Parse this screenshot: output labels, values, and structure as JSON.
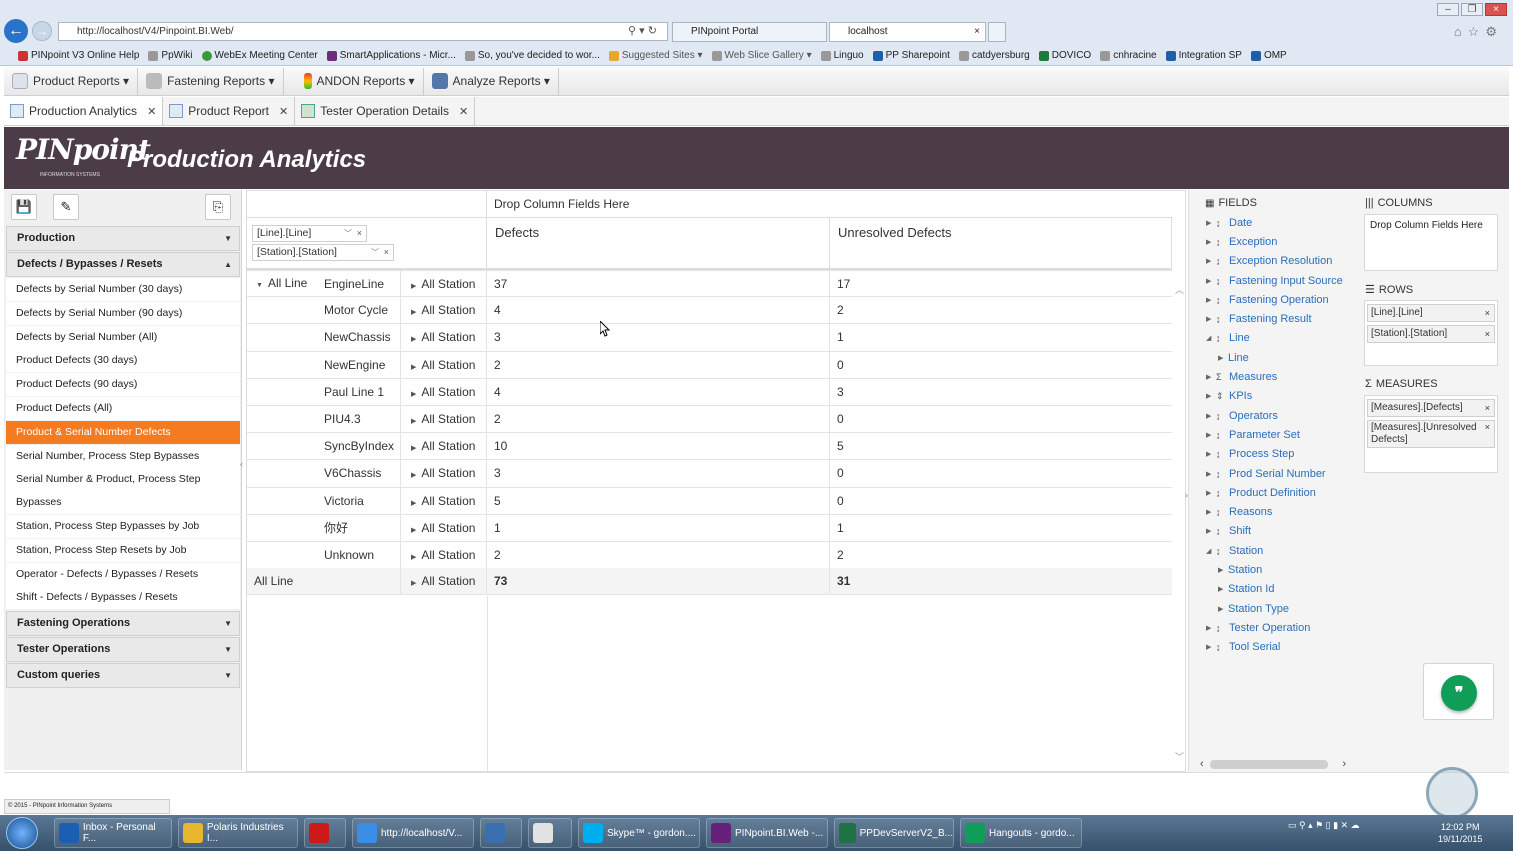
{
  "browser": {
    "url": "http://localhost/V4/Pinpoint.BI.Web/",
    "tabs": [
      "PINpoint Portal",
      "localhost"
    ],
    "favorites": [
      "PINpoint V3 Online Help",
      "PpWiki",
      "WebEx Meeting Center",
      "SmartApplications - Micr...",
      "So, you've decided to wor...",
      "Suggested Sites ▾",
      "Web Slice Gallery ▾",
      "Linguo",
      "PP Sharepoint",
      "catdyersburg",
      "DOVICO",
      "cnhracine",
      "Integration SP",
      "OMP"
    ]
  },
  "menubar": [
    "Product Reports",
    "Fastening Reports",
    "ANDON Reports",
    "Analyze Reports"
  ],
  "doctabs": [
    "Production Analytics",
    "Product Report",
    "Tester Operation Details"
  ],
  "header": {
    "logo": "PINpoint",
    "logo_sub": "INFORMATION SYSTEMS",
    "title": "Production Analytics"
  },
  "sidebar": {
    "sections_top": [
      "Production",
      "Defects / Bypasses / Resets"
    ],
    "items": [
      "Defects by Serial Number (30 days)",
      "Defects by Serial Number (90 days)",
      "Defects by Serial Number (All)",
      "Product Defects (30 days)",
      "Product Defects (90 days)",
      "Product Defects (All)",
      "Product & Serial Number Defects",
      "Serial Number, Process Step Bypasses",
      "Serial Number & Product, Process Step",
      "Bypasses",
      "Station, Process Step Bypasses by Job",
      "Station, Process Step Resets by Job",
      "Operator - Defects / Bypasses / Resets",
      "Shift - Defects / Bypasses / Resets"
    ],
    "sections_bottom": [
      "Fastening Operations",
      "Tester Operations",
      "Custom queries"
    ]
  },
  "pivot": {
    "drop_columns": "Drop Column Fields Here",
    "row_chips": [
      "[Line].[Line]",
      "[Station].[Station]"
    ],
    "columns": [
      "Defects",
      "Unresolved Defects"
    ],
    "all_line": "All Line",
    "all_station": "All Station",
    "rows": [
      {
        "name": "EngineLine",
        "defects": "37",
        "unresolved": "17"
      },
      {
        "name": "Motor Cycle",
        "defects": "4",
        "unresolved": "2"
      },
      {
        "name": "NewChassis",
        "defects": "3",
        "unresolved": "1"
      },
      {
        "name": "NewEngine",
        "defects": "2",
        "unresolved": "0"
      },
      {
        "name": "Paul Line 1",
        "defects": "4",
        "unresolved": "3"
      },
      {
        "name": "PIU4.3",
        "defects": "2",
        "unresolved": "0"
      },
      {
        "name": "SyncByIndex",
        "defects": "10",
        "unresolved": "5"
      },
      {
        "name": "V6Chassis",
        "defects": "3",
        "unresolved": "0"
      },
      {
        "name": "Victoria",
        "defects": "5",
        "unresolved": "0"
      },
      {
        "name": "你好",
        "defects": "1",
        "unresolved": "1"
      },
      {
        "name": "Unknown",
        "defects": "2",
        "unresolved": "2"
      }
    ],
    "total": {
      "defects": "73",
      "unresolved": "31"
    }
  },
  "fields_panel": {
    "fields_title": "FIELDS",
    "columns_title": "COLUMNS",
    "rows_title": "ROWS",
    "measures_title": "MEASURES",
    "columns_drop": "Drop Column Fields Here",
    "rows_chips": [
      "[Line].[Line]",
      "[Station].[Station]"
    ],
    "measures_chips": [
      "[Measures].[Defects]",
      "[Measures].[Unresolved Defects]"
    ],
    "fields": [
      "Date",
      "Exception",
      "Exception Resolution",
      "Fastening Input Source",
      "Fastening Operation",
      "Fastening Result",
      "Line",
      "Line",
      "Measures",
      "KPIs",
      "Operators",
      "Parameter Set",
      "Process Step",
      "Prod Serial Number",
      "Product Definition",
      "Reasons",
      "Shift",
      "Station",
      "Station",
      "Station Id",
      "Station Type",
      "Tester Operation",
      "Tool Serial"
    ]
  },
  "status": {
    "copyright": "© 2015 - PINpoint Information Systems"
  },
  "taskbar": {
    "tasks": [
      "Inbox - Personal F...",
      "Polaris Industries I...",
      "",
      "http://localhost/V...",
      "",
      "",
      "Skype™ - gordon....",
      "PINpoint.BI.Web -...",
      "PPDevServerV2_B...",
      "Hangouts - gordo..."
    ],
    "time": "12:02 PM",
    "date": "19/11/2015"
  },
  "colors": {
    "banner": "#4b3c48",
    "active_item": "#f47b20",
    "link": "#2a6ebb",
    "hangouts": "#0f9d58"
  }
}
